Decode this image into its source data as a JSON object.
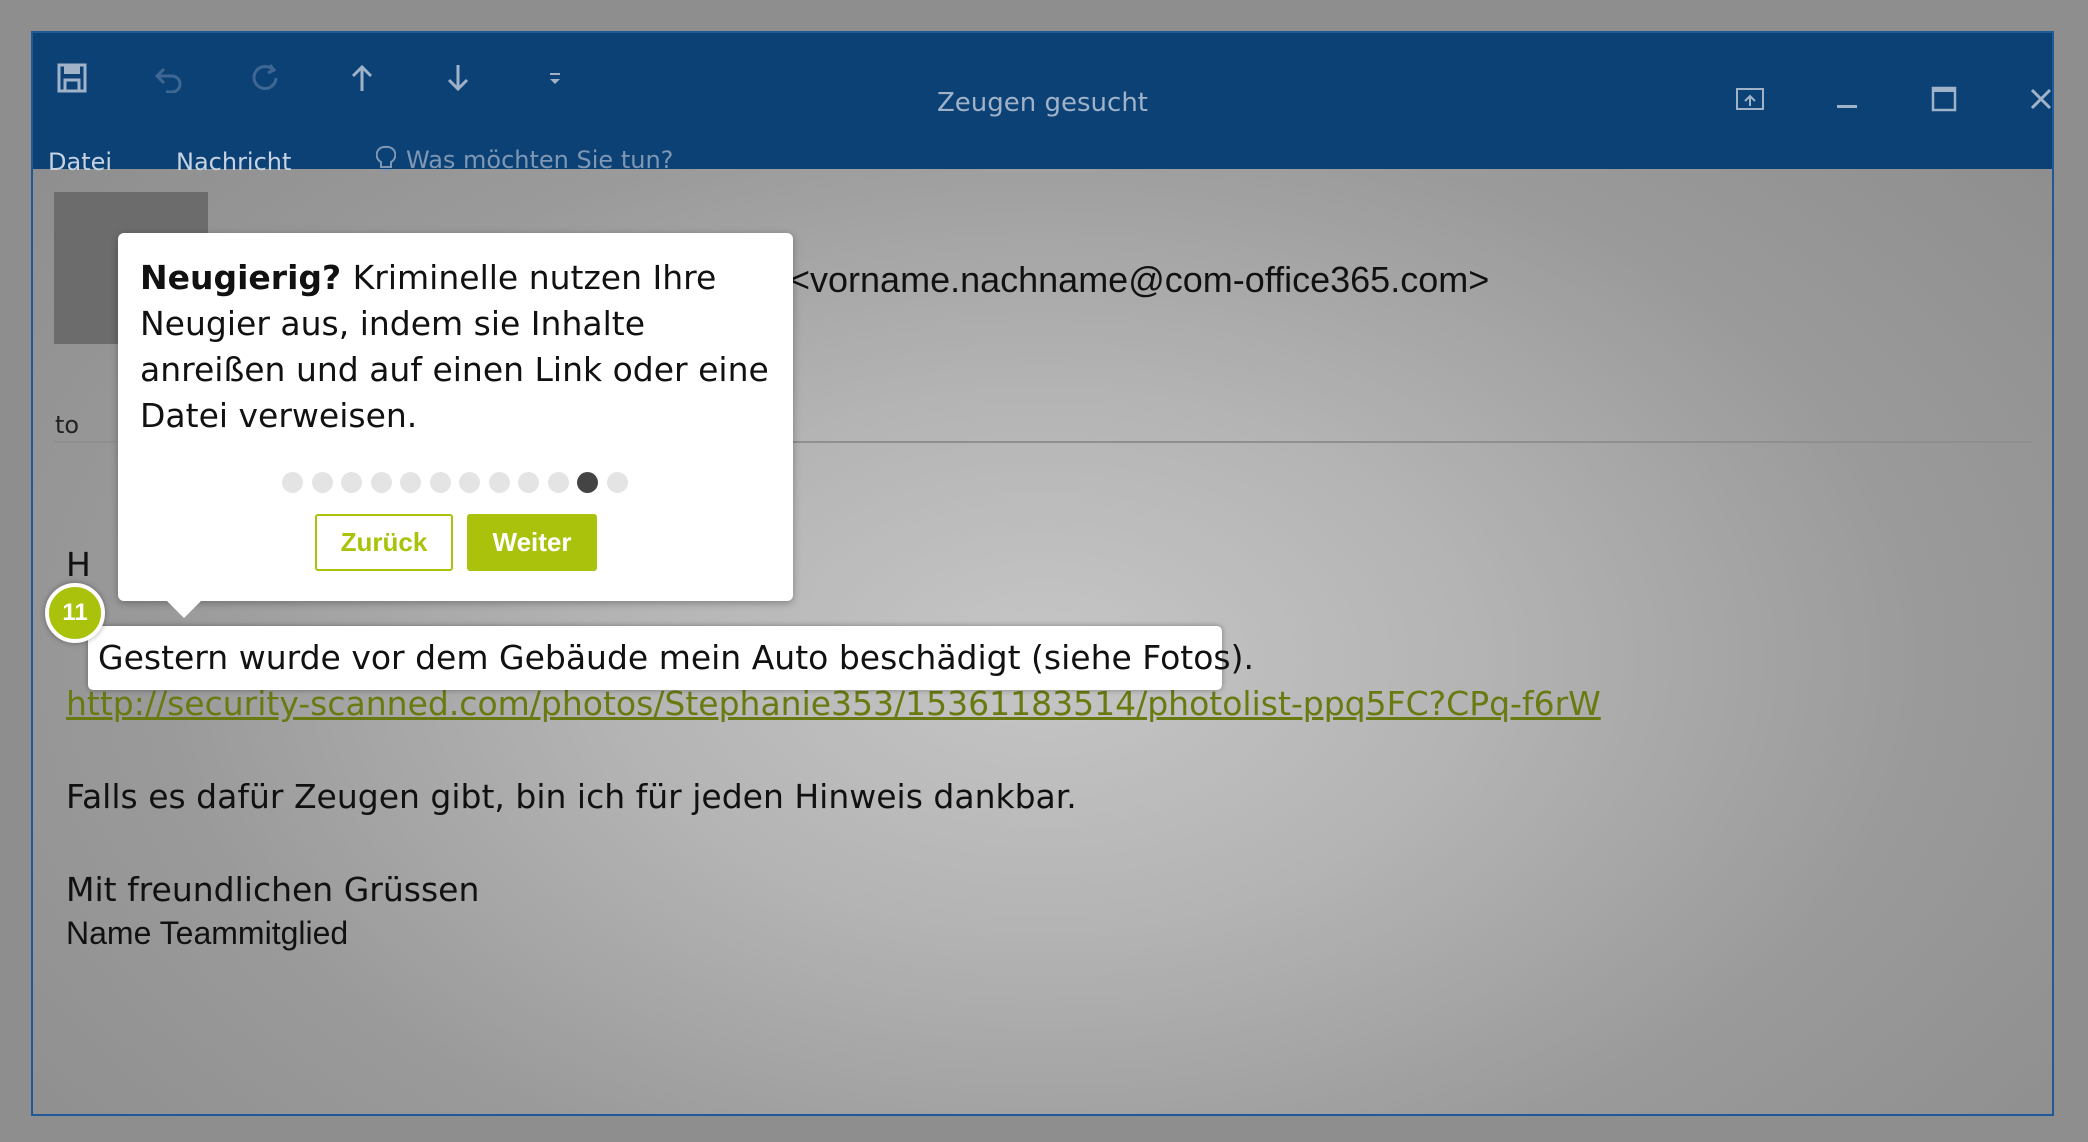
{
  "window": {
    "title": "Zeugen gesucht"
  },
  "toolbar": {
    "icons": [
      "save-icon",
      "undo-icon",
      "redo-icon",
      "arrow-up-icon",
      "arrow-down-icon",
      "customize-icon"
    ],
    "window_controls": [
      "ribbon-display-icon",
      "minimize-icon",
      "maximize-icon",
      "close-icon"
    ]
  },
  "menu": {
    "file": "Datei",
    "message": "Nachricht",
    "tell_me": "Was möchten Sie tun?"
  },
  "email": {
    "from_partial": "i <vorname.nachname@com-office365.com>",
    "to_label": "to",
    "greeting_partial": "H",
    "sentence_highlighted": "Gestern wurde vor dem Gebäude mein Auto beschädigt (siehe Fotos).",
    "link": "http://security-scanned.com/photos/Stephanie353/15361183514/photolist-ppq5FC?CPq-f6rW",
    "paragraph2": "Falls es dafür Zeugen gibt, bin ich für jeden Hinweis dankbar.",
    "closing": "Mit freundlichen Grüssen",
    "signature": "Name Teammitglied"
  },
  "tooltip": {
    "title": "Neugierig?",
    "text": "Kriminelle nutzen Ihre Neugier aus, indem sie Inhalte anreißen und auf einen Link oder eine Datei verweisen.",
    "total_steps": 12,
    "current_step_index": 10,
    "back_label": "Zurück",
    "next_label": "Weiter",
    "step_number": "11"
  },
  "colors": {
    "titlebar": "#0c4176",
    "accent_green": "#aac20c",
    "link": "#6a7a10"
  }
}
